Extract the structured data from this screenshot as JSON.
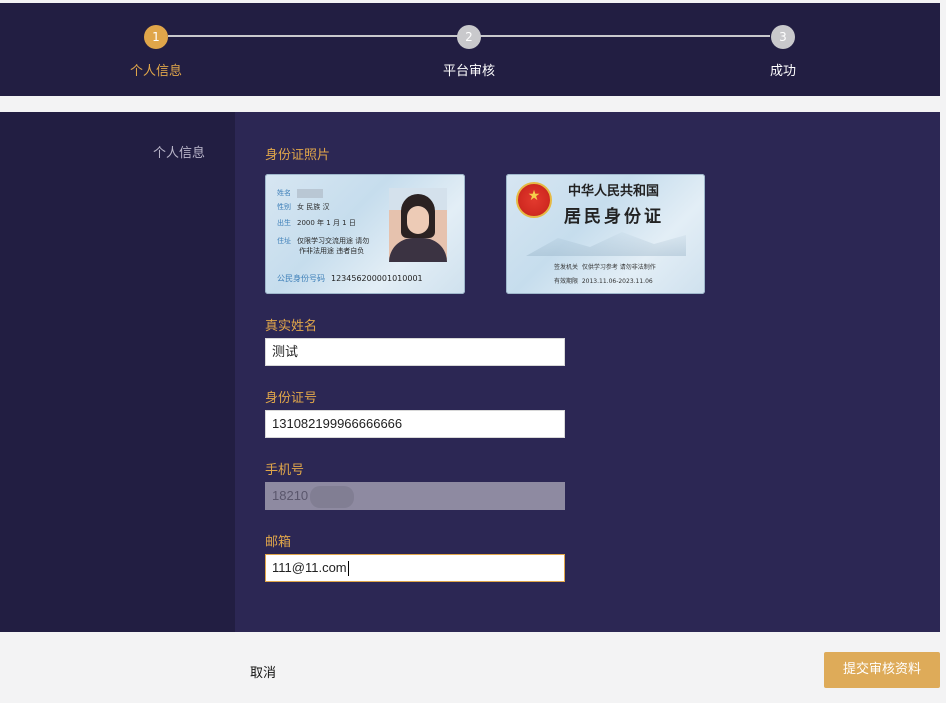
{
  "steps": [
    {
      "number": "1",
      "label": "个人信息",
      "state": "active"
    },
    {
      "number": "2",
      "label": "平台审核",
      "state": "pending"
    },
    {
      "number": "3",
      "label": "成功",
      "state": "pending"
    }
  ],
  "sidebar": {
    "label": "个人信息"
  },
  "id_photo": {
    "label": "身份证照片",
    "front": {
      "rows": [
        {
          "key": "姓名",
          "value": ""
        },
        {
          "key": "性别",
          "value": "女  民族 汉"
        },
        {
          "key": "出生",
          "value": "2000 年 1 月 1 日"
        },
        {
          "key": "住址",
          "value": "仅限学习交流用途 请勿"
        },
        {
          "key": "",
          "value": "作非法用途 违者自负"
        }
      ],
      "number_key": "公民身份号码",
      "number": "123456200001010001"
    },
    "back": {
      "title1": "中华人民共和国",
      "title2": "居民身份证",
      "authority_key": "签发机关",
      "authority": "仅供学习参考 请勿非法制作",
      "validity_key": "有效期限",
      "validity": "2013.11.06-2023.11.06"
    }
  },
  "fields": {
    "name": {
      "label": "真实姓名",
      "value": "测试"
    },
    "id_number": {
      "label": "身份证号",
      "value": "131082199966666666"
    },
    "phone": {
      "label": "手机号",
      "value": "18210"
    },
    "email": {
      "label": "邮箱",
      "value": "111@11.com"
    }
  },
  "footer": {
    "cancel": "取消",
    "submit": "提交审核资料"
  },
  "colors": {
    "accent": "#e0a64a",
    "dark_bg": "#221e42",
    "panel_bg": "#2c2754"
  }
}
